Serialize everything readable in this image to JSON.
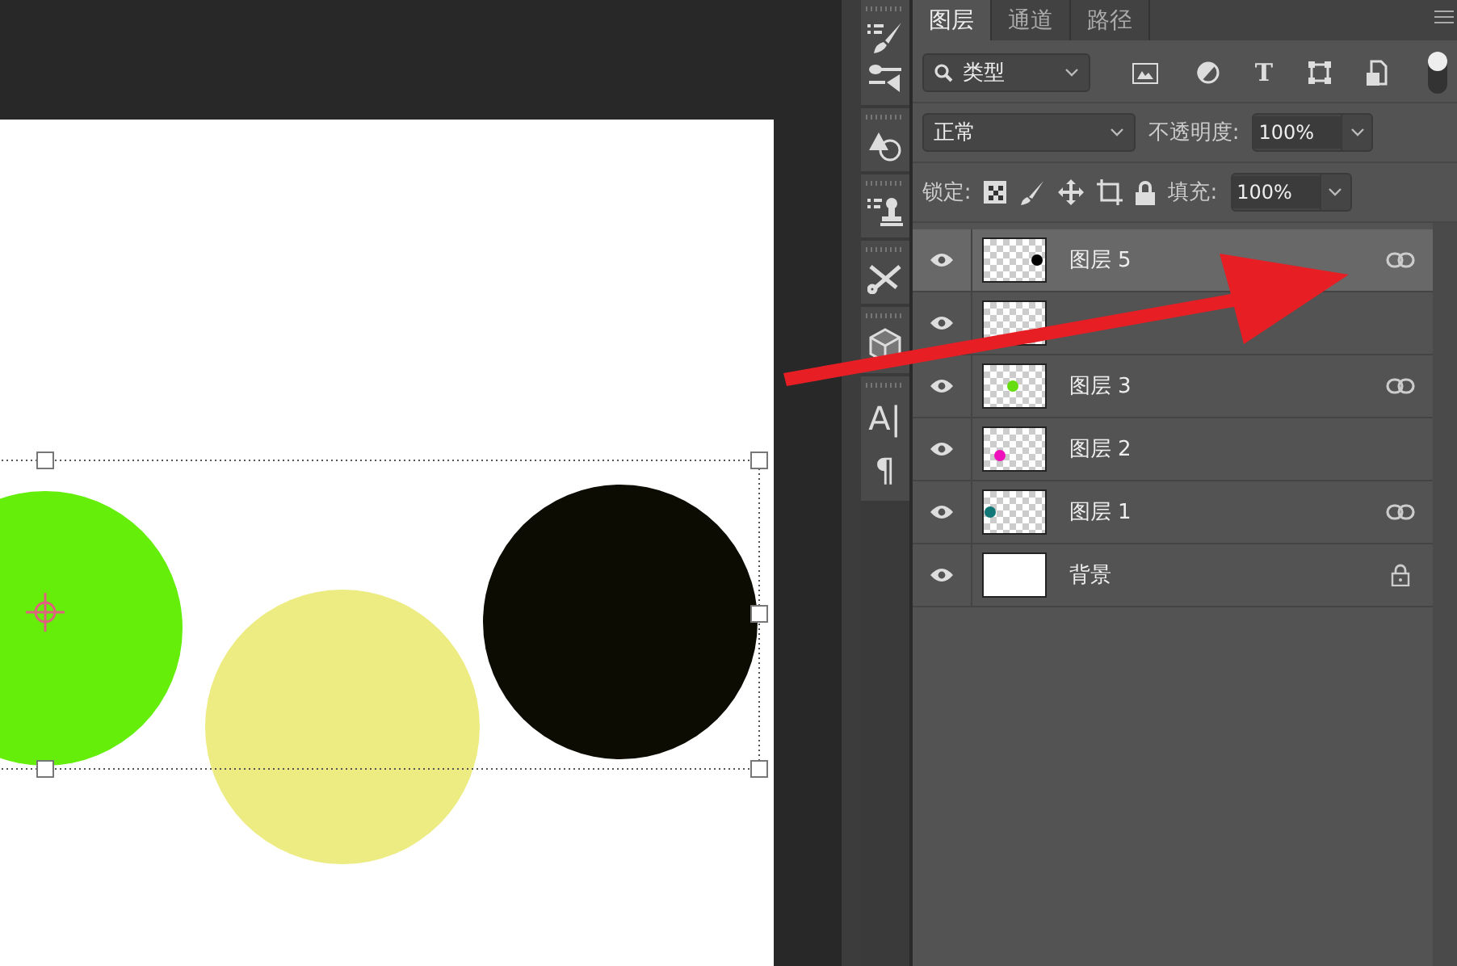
{
  "tools": [
    {
      "kind": "brush"
    },
    {
      "kind": "sliders"
    },
    {
      "kind": "shapes"
    },
    {
      "kind": "stamp"
    },
    {
      "kind": "tools"
    },
    {
      "kind": "cube"
    },
    {
      "kind": "glyph",
      "glyph": "A|"
    },
    {
      "kind": "glyph",
      "glyph": "¶"
    }
  ],
  "tabs": [
    {
      "label": "图层",
      "selected": true
    },
    {
      "label": "通道",
      "selected": false
    },
    {
      "label": "路径",
      "selected": false
    }
  ],
  "filter": {
    "value": "类型",
    "type_glyph": "T",
    "on": true
  },
  "blend_mode": {
    "value": "正常"
  },
  "opacity": {
    "label": "不透明度:",
    "value": "100%"
  },
  "lock": {
    "label": "锁定:"
  },
  "fill": {
    "label": "填充:",
    "value": "100%"
  },
  "layers": [
    {
      "name": "图层 5",
      "kind": "layer",
      "selected": true,
      "visible": true,
      "linked": true,
      "locked": false,
      "color": "#000000"
    },
    {
      "kind": "layer",
      "selected": false,
      "visible": true,
      "linked": false,
      "locked": false
    },
    {
      "name": "图层 3",
      "kind": "layer",
      "selected": false,
      "visible": true,
      "linked": true,
      "locked": false,
      "color": "#66dd11"
    },
    {
      "name": "图层 2",
      "kind": "layer",
      "selected": false,
      "visible": true,
      "linked": false,
      "locked": false,
      "color": "#ee11bb"
    },
    {
      "name": "图层 1",
      "kind": "layer",
      "selected": false,
      "visible": true,
      "linked": true,
      "locked": false,
      "color": "#117777"
    },
    {
      "name": "背景",
      "kind": "background",
      "selected": false,
      "visible": true,
      "linked": false,
      "locked": true
    }
  ]
}
